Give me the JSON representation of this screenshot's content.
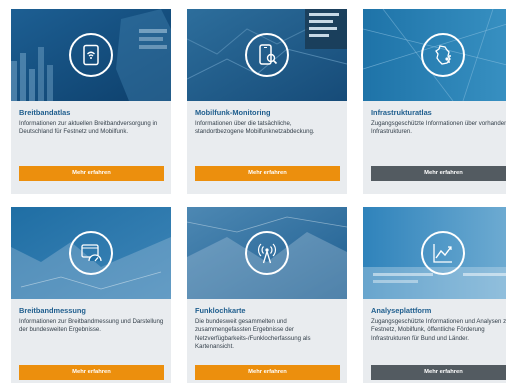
{
  "cards": [
    {
      "title": "Breitbandatlas",
      "description": "Informationen zur aktuellen Breitbandversorgung in Deutschland für Festnetz und Mobilfunk.",
      "button": "Mehr erfahren",
      "button_style": "orange",
      "icon": "tablet-wifi-icon"
    },
    {
      "title": "Mobilfunk-Monitoring",
      "description": "Informationen über die tatsächliche, standortbezogene Mobilfunknetzabdeckung.",
      "button": "Mehr erfahren",
      "button_style": "orange",
      "icon": "phone-search-icon"
    },
    {
      "title": "Infrastrukturatlas",
      "description": "Zugangsgeschützte Informationen über vorhandene Infrastrukturen.",
      "button": "Mehr erfahren",
      "button_style": "gray",
      "icon": "germany-map-icon"
    },
    {
      "title": "Breitbandmessung",
      "description": "Informationen zur Breitbandmessung und Darstellung der bundesweiten Ergebnisse.",
      "button": "Mehr erfahren",
      "button_style": "orange",
      "icon": "speedometer-icon"
    },
    {
      "title": "Funklochkarte",
      "description": "Die bundesweit gesammelten und zusammengefassten Ergebnisse der Netzverfügbarkeits-/Funklocherfassung als Kartenansicht.",
      "button": "Mehr erfahren",
      "button_style": "orange",
      "icon": "antenna-icon"
    },
    {
      "title": "Analyseplattform",
      "description": "Zugangsgeschützte Informationen und Analysen zu Festnetz, Mobilfunk, öffentliche Förderung Infrastrukturen für Bund und Länder.",
      "button": "Mehr erfahren",
      "button_style": "gray",
      "icon": "line-chart-icon"
    }
  ],
  "colors": {
    "title": "#1f5e8e",
    "orange_button": "#ec8f0d",
    "gray_button": "#535b61",
    "card_bg": "#e9ecef"
  }
}
